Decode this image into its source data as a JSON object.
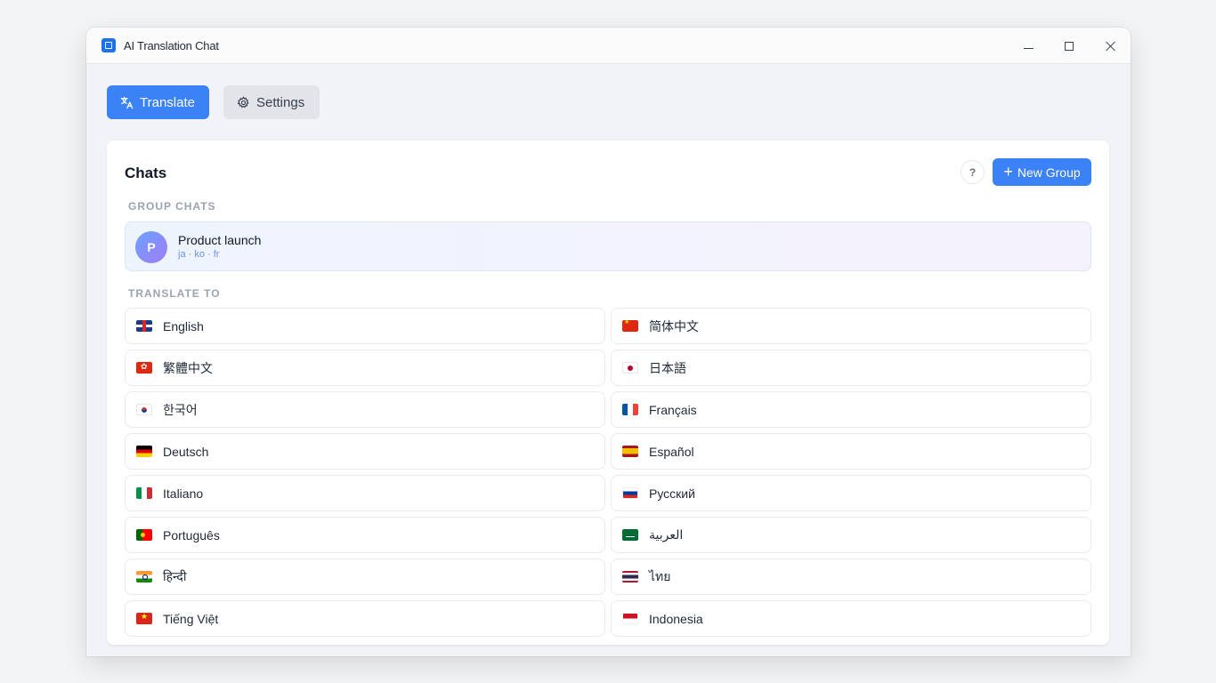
{
  "window": {
    "title": "AI Translation Chat"
  },
  "tabs": [
    {
      "label": "Translate",
      "active": true,
      "icon": "translate-icon"
    },
    {
      "label": "Settings",
      "active": false,
      "icon": "gear-icon"
    }
  ],
  "chats": {
    "title": "Chats",
    "help_label": "?",
    "new_group_label": "New Group",
    "group_section_label": "GROUP CHATS",
    "groups": [
      {
        "avatar": "P",
        "name": "Product launch",
        "langs": "ja · ko · fr"
      }
    ],
    "translate_section_label": "TRANSLATE TO",
    "languages": [
      {
        "name": "English",
        "flag": "gb"
      },
      {
        "name": "简体中文",
        "flag": "cn"
      },
      {
        "name": "繁體中文",
        "flag": "hk"
      },
      {
        "name": "日本語",
        "flag": "jp"
      },
      {
        "name": "한국어",
        "flag": "kr"
      },
      {
        "name": "Français",
        "flag": "fr"
      },
      {
        "name": "Deutsch",
        "flag": "de"
      },
      {
        "name": "Español",
        "flag": "es"
      },
      {
        "name": "Italiano",
        "flag": "it"
      },
      {
        "name": "Русский",
        "flag": "ru"
      },
      {
        "name": "Português",
        "flag": "pt"
      },
      {
        "name": "العربية",
        "flag": "sa"
      },
      {
        "name": "हिन्दी",
        "flag": "in"
      },
      {
        "name": "ไทย",
        "flag": "th"
      },
      {
        "name": "Tiếng Việt",
        "flag": "vn"
      },
      {
        "name": "Indonesia",
        "flag": "id"
      }
    ]
  },
  "colors": {
    "accent": "#3b82f6",
    "background": "#f1f3f6",
    "card": "#ffffff"
  }
}
